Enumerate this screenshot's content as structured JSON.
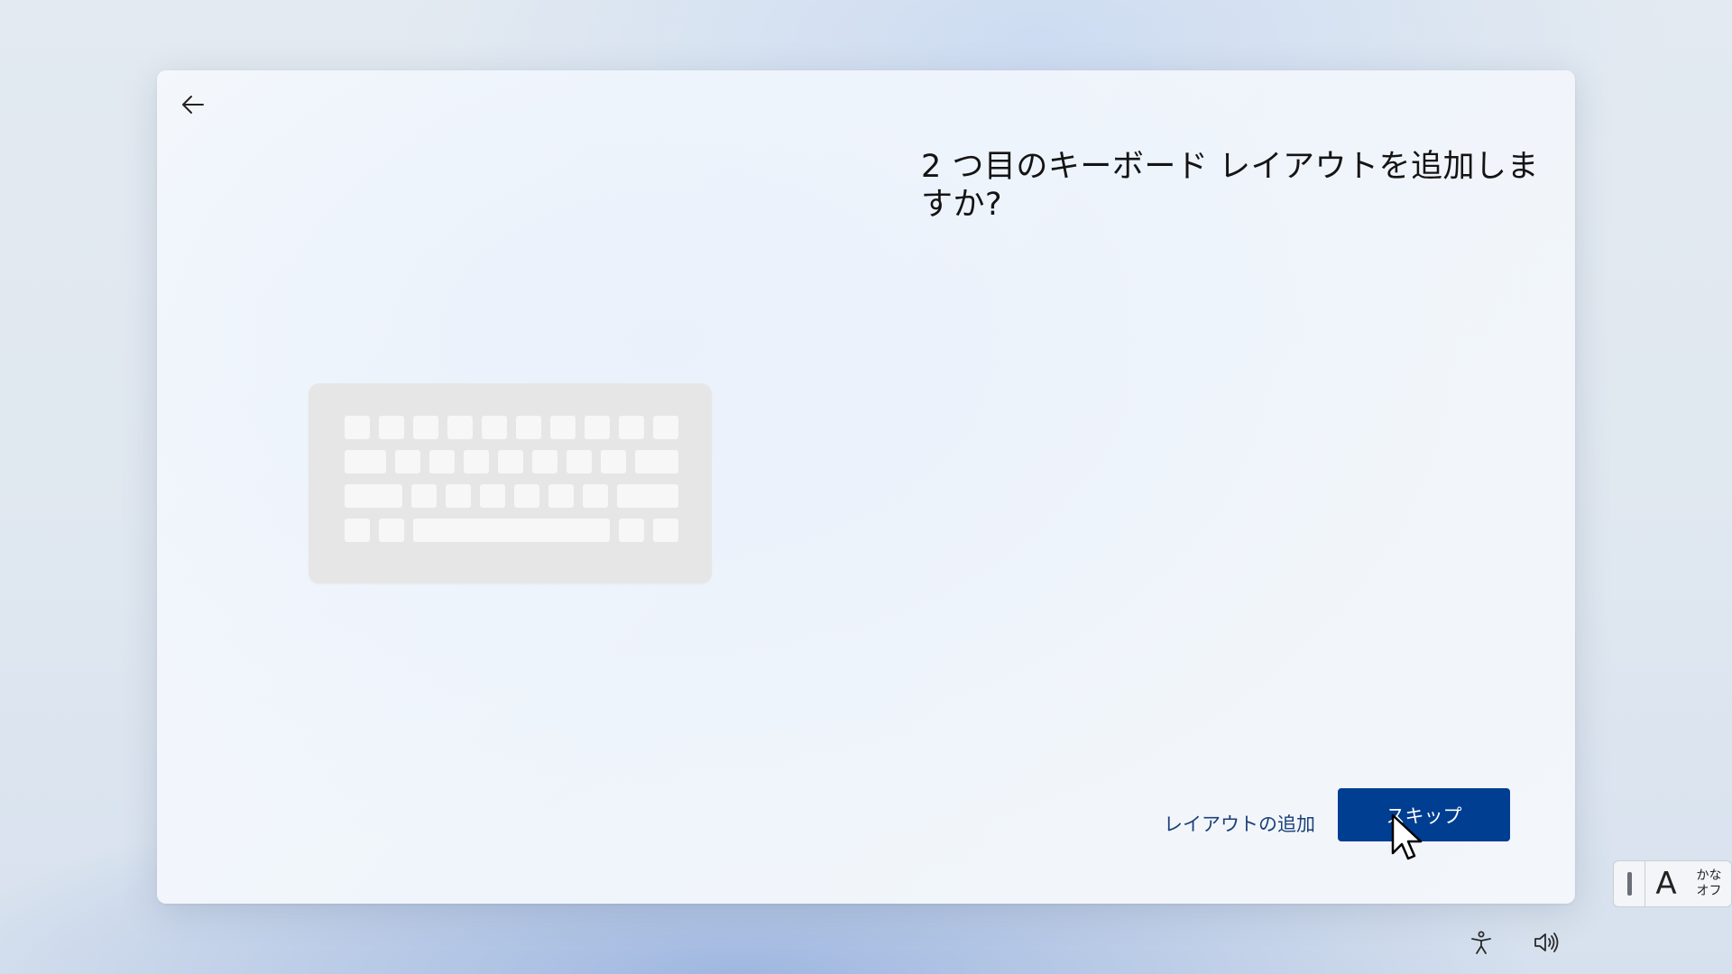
{
  "page": {
    "title": "2 つ目のキーボード レイアウトを追加しますか?"
  },
  "header": {
    "back_icon": "arrow-left-icon"
  },
  "actions": {
    "add_layout_label": "レイアウトの追加",
    "skip_label": "スキップ"
  },
  "illustration": {
    "icon": "keyboard-icon"
  },
  "ime": {
    "mode_label": "A",
    "kana_line1": "かな",
    "kana_line2": "オフ"
  },
  "tray": {
    "accessibility_icon": "accessibility-icon",
    "volume_icon": "volume-icon"
  },
  "colors": {
    "primary_button": "#003e92",
    "link": "#1a3f7a",
    "keyboard_body": "#e6e6e6",
    "keyboard_key": "#f7f7f7"
  }
}
